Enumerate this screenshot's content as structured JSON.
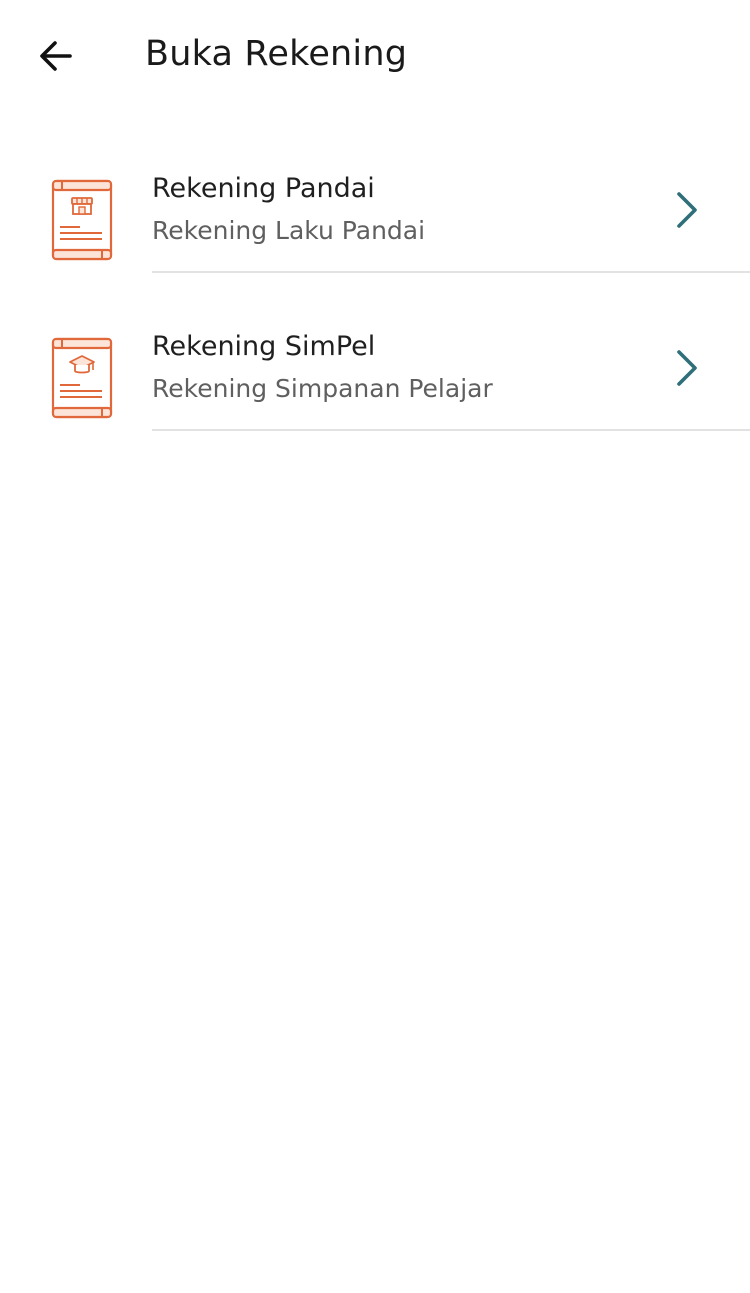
{
  "header": {
    "back_icon": "arrow-left-icon",
    "title": "Buka Rekening"
  },
  "colors": {
    "icon_accent": "#e0683a",
    "icon_fill": "#fde4d8",
    "chevron": "#2f6f7a",
    "divider": "#e2e2e2"
  },
  "items": [
    {
      "icon": "storefront-document-icon",
      "title": "Rekening Pandai",
      "subtitle": "Rekening Laku Pandai",
      "chevron_icon": "chevron-right-icon"
    },
    {
      "icon": "graduation-cap-document-icon",
      "title": "Rekening SimPel",
      "subtitle": "Rekening Simpanan Pelajar",
      "chevron_icon": "chevron-right-icon"
    }
  ]
}
